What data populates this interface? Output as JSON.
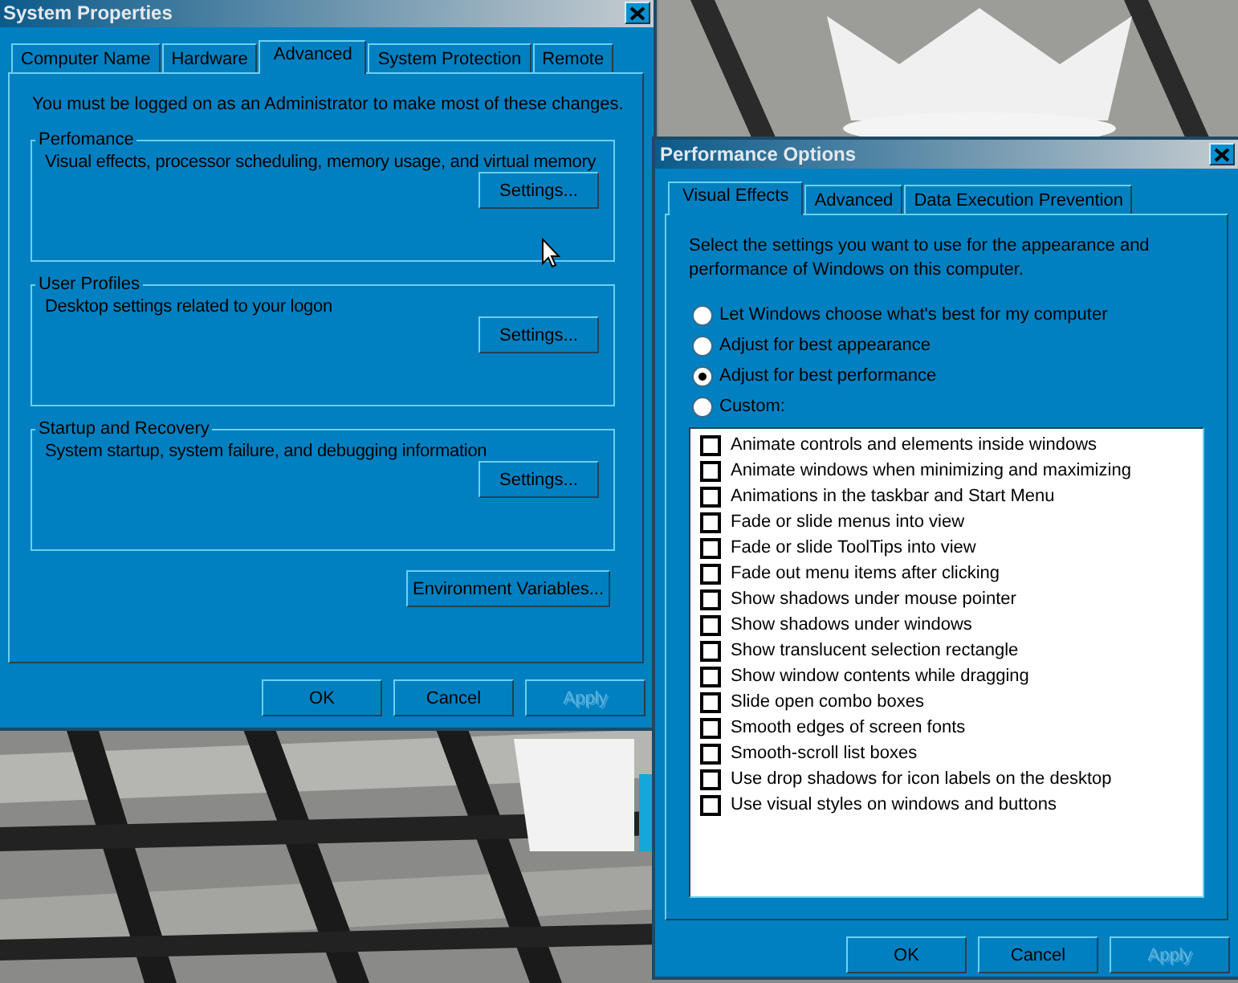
{
  "system_properties": {
    "title": "System Properties",
    "tabs": [
      {
        "label": "Computer Name",
        "selected": false
      },
      {
        "label": "Hardware",
        "selected": false
      },
      {
        "label": "Advanced",
        "selected": true
      },
      {
        "label": "System Protection",
        "selected": false
      },
      {
        "label": "Remote",
        "selected": false
      }
    ],
    "notice": "You must be logged on as an Administrator to make most of these changes.",
    "groups": [
      {
        "title": "Perfomance",
        "description": "Visual effects, processor scheduling, memory usage, and virtual memory",
        "button": "Settings..."
      },
      {
        "title": "User Profiles",
        "description": "Desktop settings related to your logon",
        "button": "Settings..."
      },
      {
        "title": "Startup and Recovery",
        "description": "System startup, system failure, and debugging information",
        "button": "Settings..."
      }
    ],
    "environment_button": "Environment Variables...",
    "buttons": [
      {
        "label": "OK",
        "disabled": false
      },
      {
        "label": "Cancel",
        "disabled": false
      },
      {
        "label": "Apply",
        "disabled": true
      }
    ]
  },
  "performance_options": {
    "title": "Performance Options",
    "tabs": [
      {
        "label": "Visual Effects",
        "selected": true
      },
      {
        "label": "Advanced",
        "selected": false
      },
      {
        "label": "Data Execution Prevention",
        "selected": false
      }
    ],
    "intro": "Select the settings you want to use for the appearance and performance of Windows on this computer.",
    "options": [
      {
        "label": "Let Windows choose what's best for my computer",
        "selected": false
      },
      {
        "label": "Adjust for best appearance",
        "selected": false
      },
      {
        "label": "Adjust for best performance",
        "selected": true
      },
      {
        "label": "Custom:",
        "selected": false
      }
    ],
    "effects": [
      {
        "label": "Animate controls and elements inside windows",
        "checked": false
      },
      {
        "label": "Animate windows when minimizing and maximizing",
        "checked": false
      },
      {
        "label": "Animations in the taskbar and Start Menu",
        "checked": false
      },
      {
        "label": "Fade or slide menus into view",
        "checked": false
      },
      {
        "label": "Fade or slide ToolTips into view",
        "checked": false
      },
      {
        "label": "Fade out menu items after clicking",
        "checked": false
      },
      {
        "label": "Show shadows under mouse pointer",
        "checked": false
      },
      {
        "label": "Show shadows under windows",
        "checked": false
      },
      {
        "label": "Show translucent selection rectangle",
        "checked": false
      },
      {
        "label": "Show window contents while dragging",
        "checked": false
      },
      {
        "label": "Slide open combo boxes",
        "checked": false
      },
      {
        "label": "Smooth edges of screen fonts",
        "checked": false
      },
      {
        "label": "Smooth-scroll list boxes",
        "checked": false
      },
      {
        "label": "Use drop shadows for icon labels on the desktop",
        "checked": false
      },
      {
        "label": "Use visual styles on windows and buttons",
        "checked": false
      }
    ],
    "buttons": [
      {
        "label": "OK",
        "disabled": false
      },
      {
        "label": "Cancel",
        "disabled": false
      },
      {
        "label": "Apply",
        "disabled": true
      }
    ]
  }
}
